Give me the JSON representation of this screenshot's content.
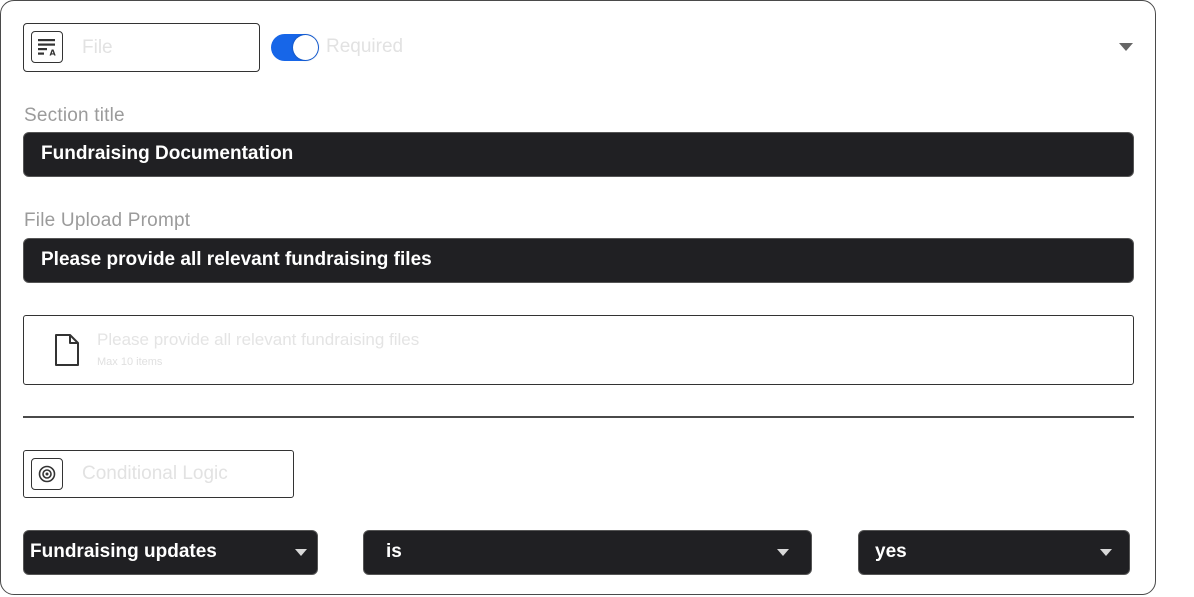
{
  "field_type": {
    "label": "File",
    "icon": "text-format-icon"
  },
  "required": {
    "label": "Required",
    "on": true,
    "color": "#1766e8"
  },
  "section_title": {
    "label": "Section title",
    "value": "Fundraising Documentation"
  },
  "upload_prompt": {
    "label": "File Upload Prompt",
    "value": "Please provide all relevant fundraising files"
  },
  "upload_preview": {
    "title": "Please provide all relevant fundraising files",
    "subtitle": "Max 10 items",
    "icon": "file-icon"
  },
  "conditional": {
    "label": "Conditional Logic",
    "icon": "target-icon"
  },
  "condition": {
    "field": "Fundraising updates",
    "operator": "is",
    "value": "yes"
  }
}
